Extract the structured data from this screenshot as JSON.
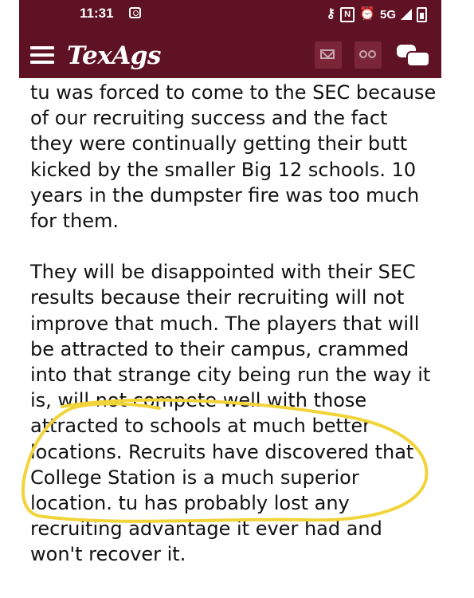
{
  "status_bar": {
    "time": "11:31",
    "network": "5G"
  },
  "navbar": {
    "logo": "TexAgs"
  },
  "post": {
    "paragraph1": [
      "tu was forced to come to the SEC because",
      "of our recruiting success and the fact",
      "they were continually getting their butt",
      "kicked by the smaller Big 12 schools. 10",
      "years in the dumpster fire was too much",
      "for them."
    ],
    "paragraph2": [
      "They will be disappointed with their SEC",
      "results because their recruiting will not",
      "improve that much. The players that will",
      "be attracted to their campus, crammed",
      "into that strange city being run the way it",
      "is, will not compete well with those",
      "attracted to schools at much better",
      "locations. Recruits have discovered that",
      "College Station is a much superior",
      "location. tu has probably lost any",
      "recruiting advantage it ever had and",
      "won't recover it."
    ]
  },
  "colors": {
    "brand": "#5e1224",
    "highlight": "#f2d43a"
  },
  "icons": [
    "menu-icon",
    "mail-icon",
    "binoculars-icon",
    "chat-icon"
  ]
}
